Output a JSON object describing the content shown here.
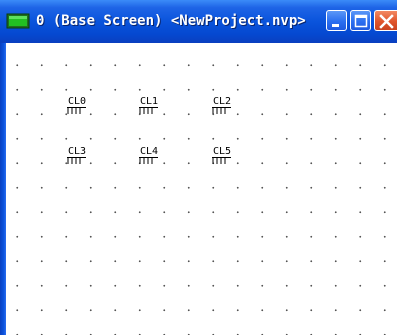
{
  "window": {
    "title": "0 (Base Screen) <NewProject.nvp>",
    "accent": "#0a54dc"
  },
  "titlebar_buttons": [
    {
      "name": "minimize",
      "icon": "minimize-icon"
    },
    {
      "name": "maximize",
      "icon": "maximize-icon"
    },
    {
      "name": "close",
      "icon": "close-icon"
    }
  ],
  "canvas": {
    "grid": "dotted",
    "background": "#ffffff"
  },
  "lamps": [
    {
      "label": "CL0"
    },
    {
      "label": "CL1"
    },
    {
      "label": "CL2"
    },
    {
      "label": "CL3"
    },
    {
      "label": "CL4"
    },
    {
      "label": "CL5"
    }
  ]
}
